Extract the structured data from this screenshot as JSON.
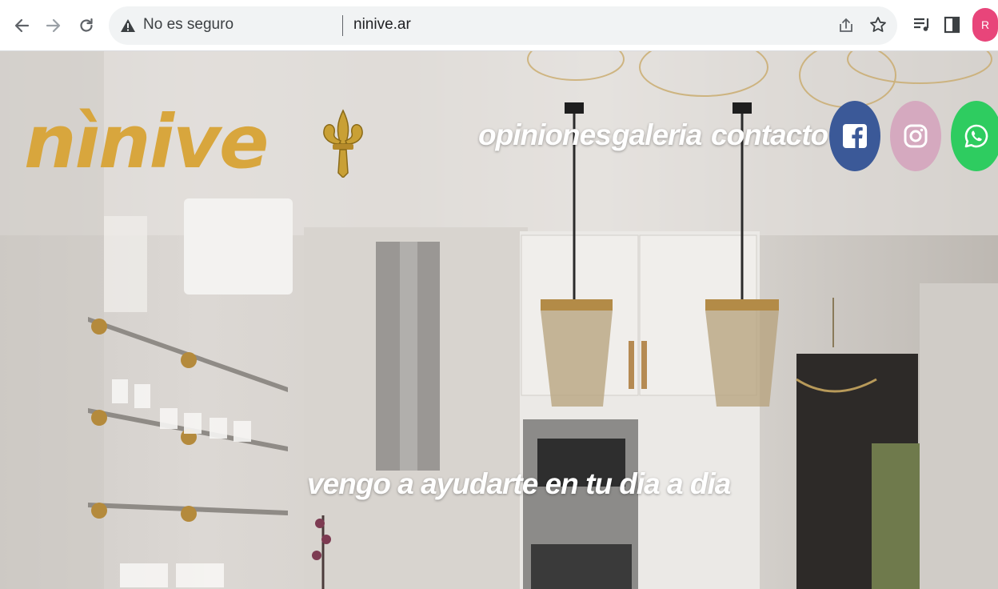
{
  "browser": {
    "security_label": "No es seguro",
    "url": "ninive.ar",
    "profile_initial": "R",
    "icons": [
      "back-arrow-icon",
      "forward-arrow-icon",
      "reload-icon",
      "warning-icon",
      "share-icon",
      "star-icon",
      "media-control-icon",
      "side-panel-icon"
    ]
  },
  "site": {
    "logo": "nìnive",
    "nav": {
      "opiniones": "opiniones",
      "galeria": "galeria",
      "contacto": "contacto"
    },
    "social": [
      {
        "name": "facebook-icon",
        "color": "#3b5998"
      },
      {
        "name": "instagram-icon",
        "color": "#d5a9bf"
      },
      {
        "name": "whatsapp-icon",
        "color": "#2ecc60"
      }
    ],
    "tagline": "vengo a ayudarte en tu dia a dia",
    "colors": {
      "logo": "#d8a63d",
      "text": "#ffffff"
    }
  }
}
